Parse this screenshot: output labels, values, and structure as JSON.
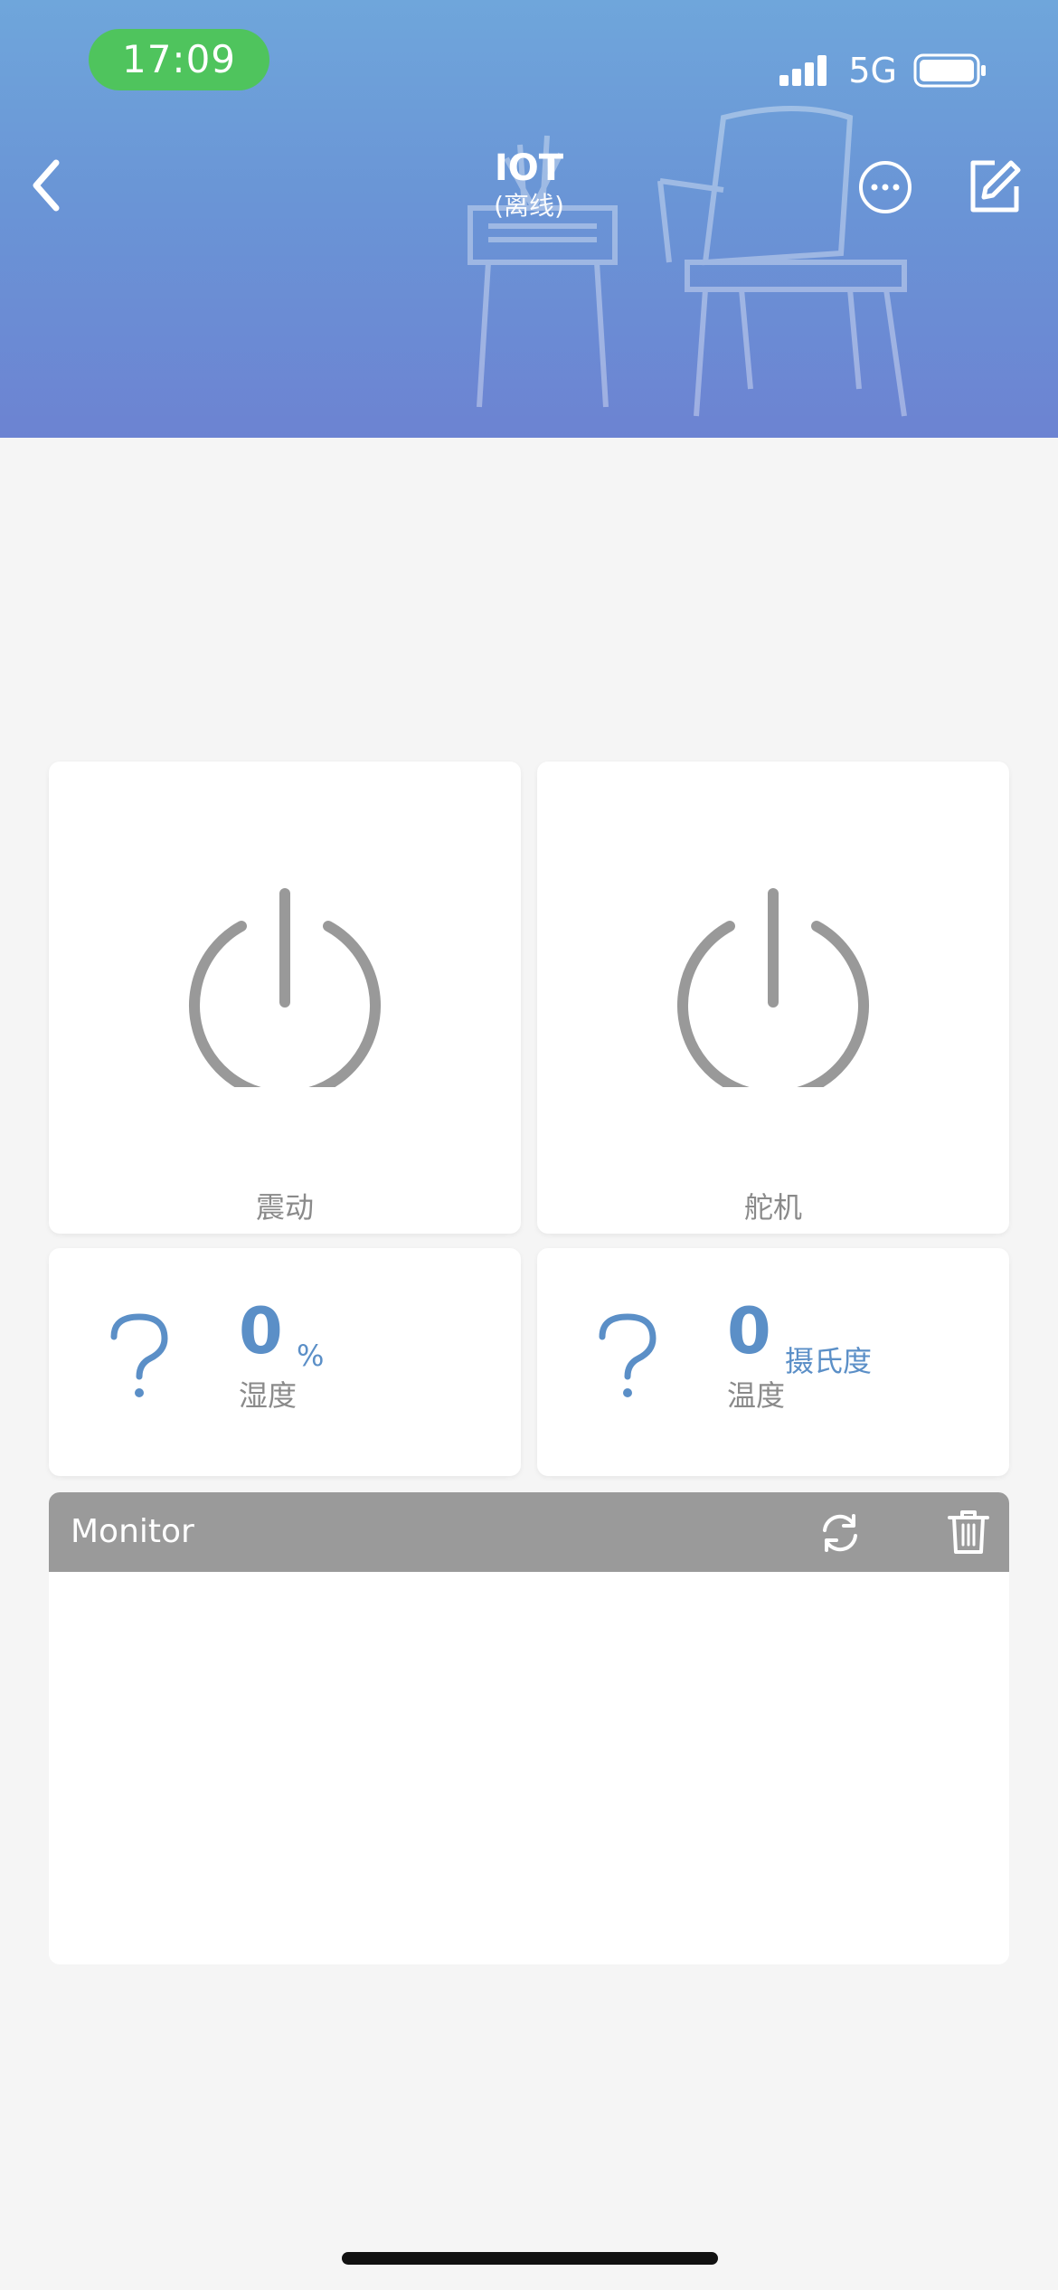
{
  "status_bar": {
    "time": "17:09",
    "network": "5G"
  },
  "header": {
    "title": "IOT",
    "subtitle": "(离线)"
  },
  "switches": [
    {
      "label": "震动"
    },
    {
      "label": "舵机"
    }
  ],
  "sensors": [
    {
      "value": "0",
      "unit": "%",
      "name": "湿度"
    },
    {
      "value": "0",
      "unit": "摄氏度",
      "name": "温度"
    }
  ],
  "monitor": {
    "title": "Monitor"
  },
  "colors": {
    "accent": "#5b8fc7",
    "status_green": "#4fc45d",
    "monitor_bar": "#9a9a9a"
  }
}
